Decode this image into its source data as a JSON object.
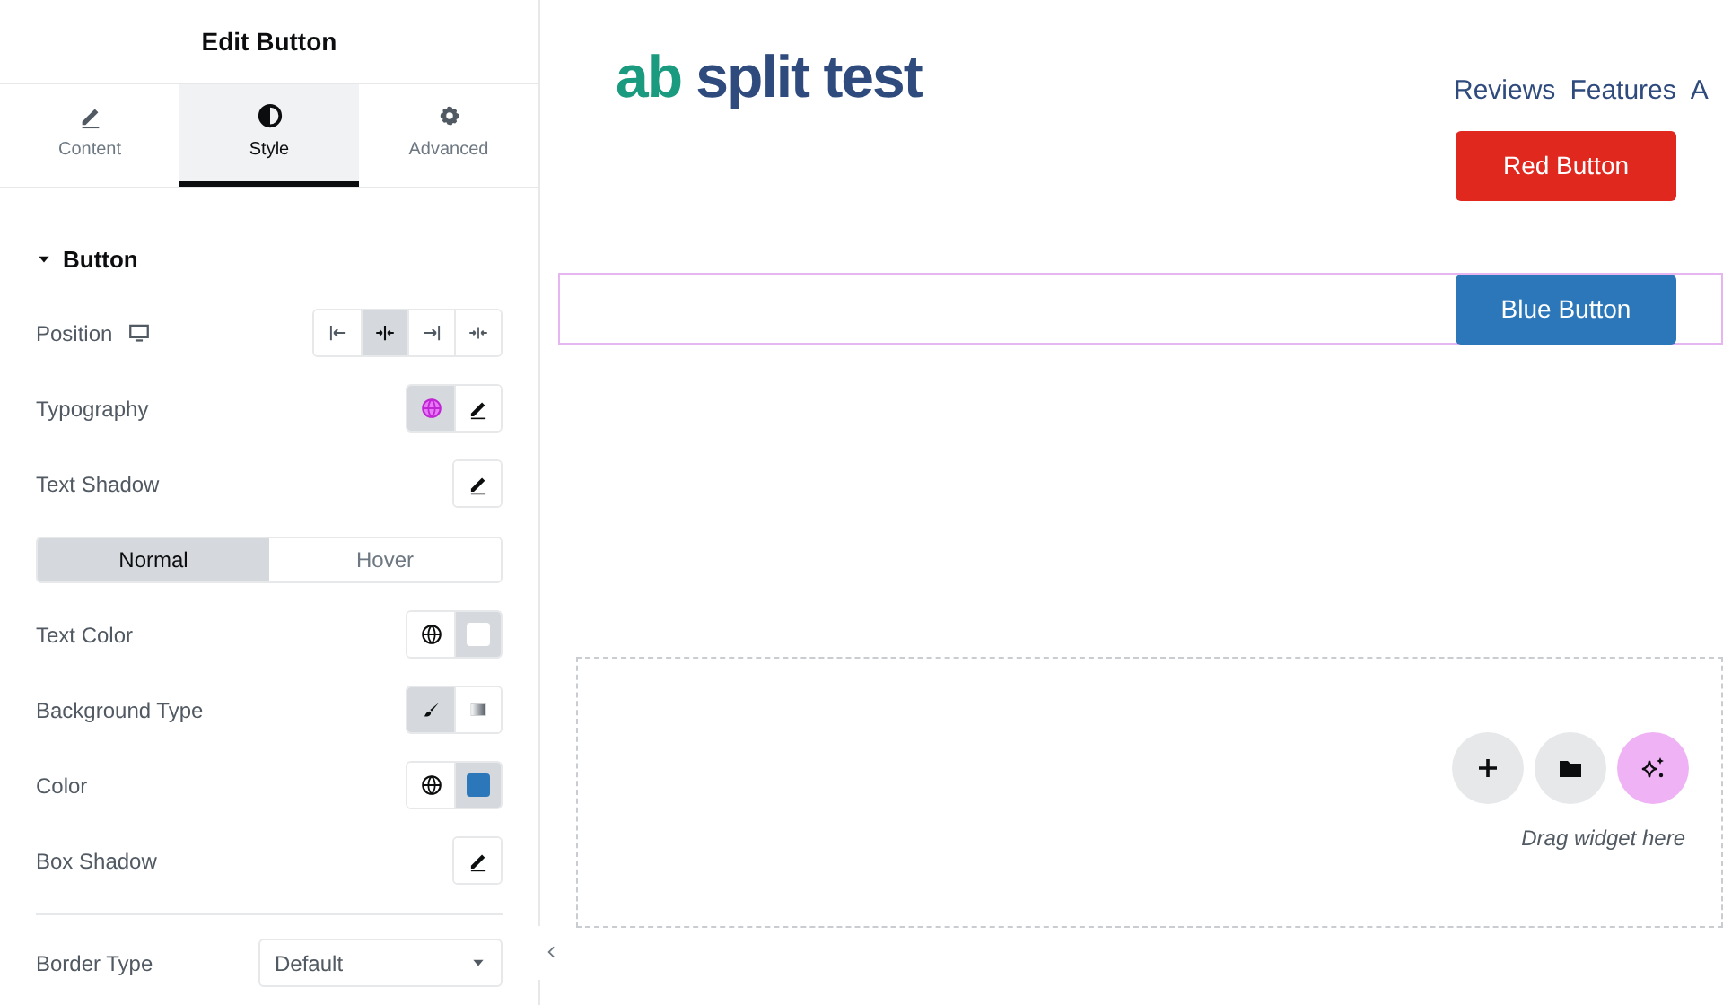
{
  "panel": {
    "title": "Edit Button",
    "tabs": [
      {
        "label": "Content",
        "selected": false
      },
      {
        "label": "Style",
        "selected": true
      },
      {
        "label": "Advanced",
        "selected": false
      }
    ],
    "section": {
      "title": "Button",
      "expanded": true
    },
    "controls": [
      {
        "kind": "choices",
        "label": "Position",
        "responsive": true,
        "options": [
          {
            "selected": false
          },
          {
            "selected": true
          },
          {
            "selected": false
          },
          {
            "selected": false
          }
        ]
      },
      {
        "kind": "global-edit",
        "label": "Typography",
        "global_active": true
      },
      {
        "kind": "edit",
        "label": "Text Shadow"
      },
      {
        "kind": "state-tabs",
        "tabs": [
          {
            "label": "Normal",
            "selected": true
          },
          {
            "label": "Hover",
            "selected": false
          }
        ]
      },
      {
        "kind": "color",
        "label": "Text Color",
        "color": "#ffffff"
      },
      {
        "kind": "bg-type",
        "label": "Background Type",
        "options": [
          {
            "selected": true
          },
          {
            "selected": false
          }
        ]
      },
      {
        "kind": "color",
        "label": "Color",
        "color": "#2b77b9"
      },
      {
        "kind": "edit",
        "label": "Box Shadow"
      },
      {
        "kind": "select",
        "label": "Border Type",
        "value": "Default"
      }
    ]
  },
  "site": {
    "logo_mark": "ab",
    "logo_text": "split test",
    "nav": [
      "Reviews",
      "Features",
      "A"
    ],
    "buttons": [
      {
        "label": "Red Button",
        "color": "#e0281f",
        "selected": false
      },
      {
        "label": "Blue Button",
        "color": "#2b77b9",
        "selected": true
      }
    ],
    "drop_zone": {
      "hint": "Drag widget here"
    }
  }
}
